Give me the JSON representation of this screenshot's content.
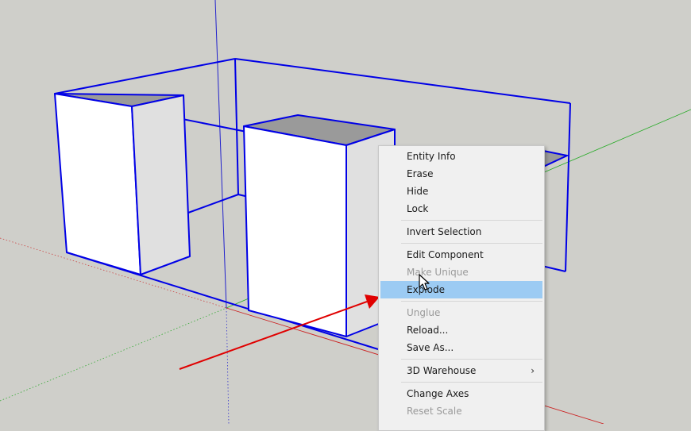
{
  "context_menu": {
    "groups": [
      [
        {
          "label": "Entity Info",
          "enabled": true
        },
        {
          "label": "Erase",
          "enabled": true
        },
        {
          "label": "Hide",
          "enabled": true
        },
        {
          "label": "Lock",
          "enabled": true
        }
      ],
      [
        {
          "label": "Invert Selection",
          "enabled": true
        }
      ],
      [
        {
          "label": "Edit Component",
          "enabled": true
        },
        {
          "label": "Make Unique",
          "enabled": false
        },
        {
          "label": "Explode",
          "enabled": true,
          "highlighted": true
        }
      ],
      [
        {
          "label": "Unglue",
          "enabled": false
        },
        {
          "label": "Reload...",
          "enabled": true
        },
        {
          "label": "Save As...",
          "enabled": true
        }
      ],
      [
        {
          "label": "3D Warehouse",
          "enabled": true,
          "submenu": true
        }
      ],
      [
        {
          "label": "Change Axes",
          "enabled": true
        },
        {
          "label": "Reset Scale",
          "enabled": false
        }
      ]
    ],
    "submenu_arrow": "›"
  },
  "icons": {
    "cursor": "mouse-pointer-icon",
    "annotation": "red-arrow-annotation"
  },
  "colors": {
    "background": "#cfcfca",
    "selection_edge": "#0000e6",
    "face_front": "#ffffff",
    "face_side": "#e0e0e0",
    "face_top": "#9a9a9a",
    "menu_background": "#f0f0f0",
    "menu_highlight": "#9ccbf3",
    "menu_disabled_text": "#9a9a9a",
    "axis_red": "#cc0000",
    "axis_green": "#00a000",
    "axis_blue": "#0000cc",
    "annotation_arrow": "#e00000"
  }
}
